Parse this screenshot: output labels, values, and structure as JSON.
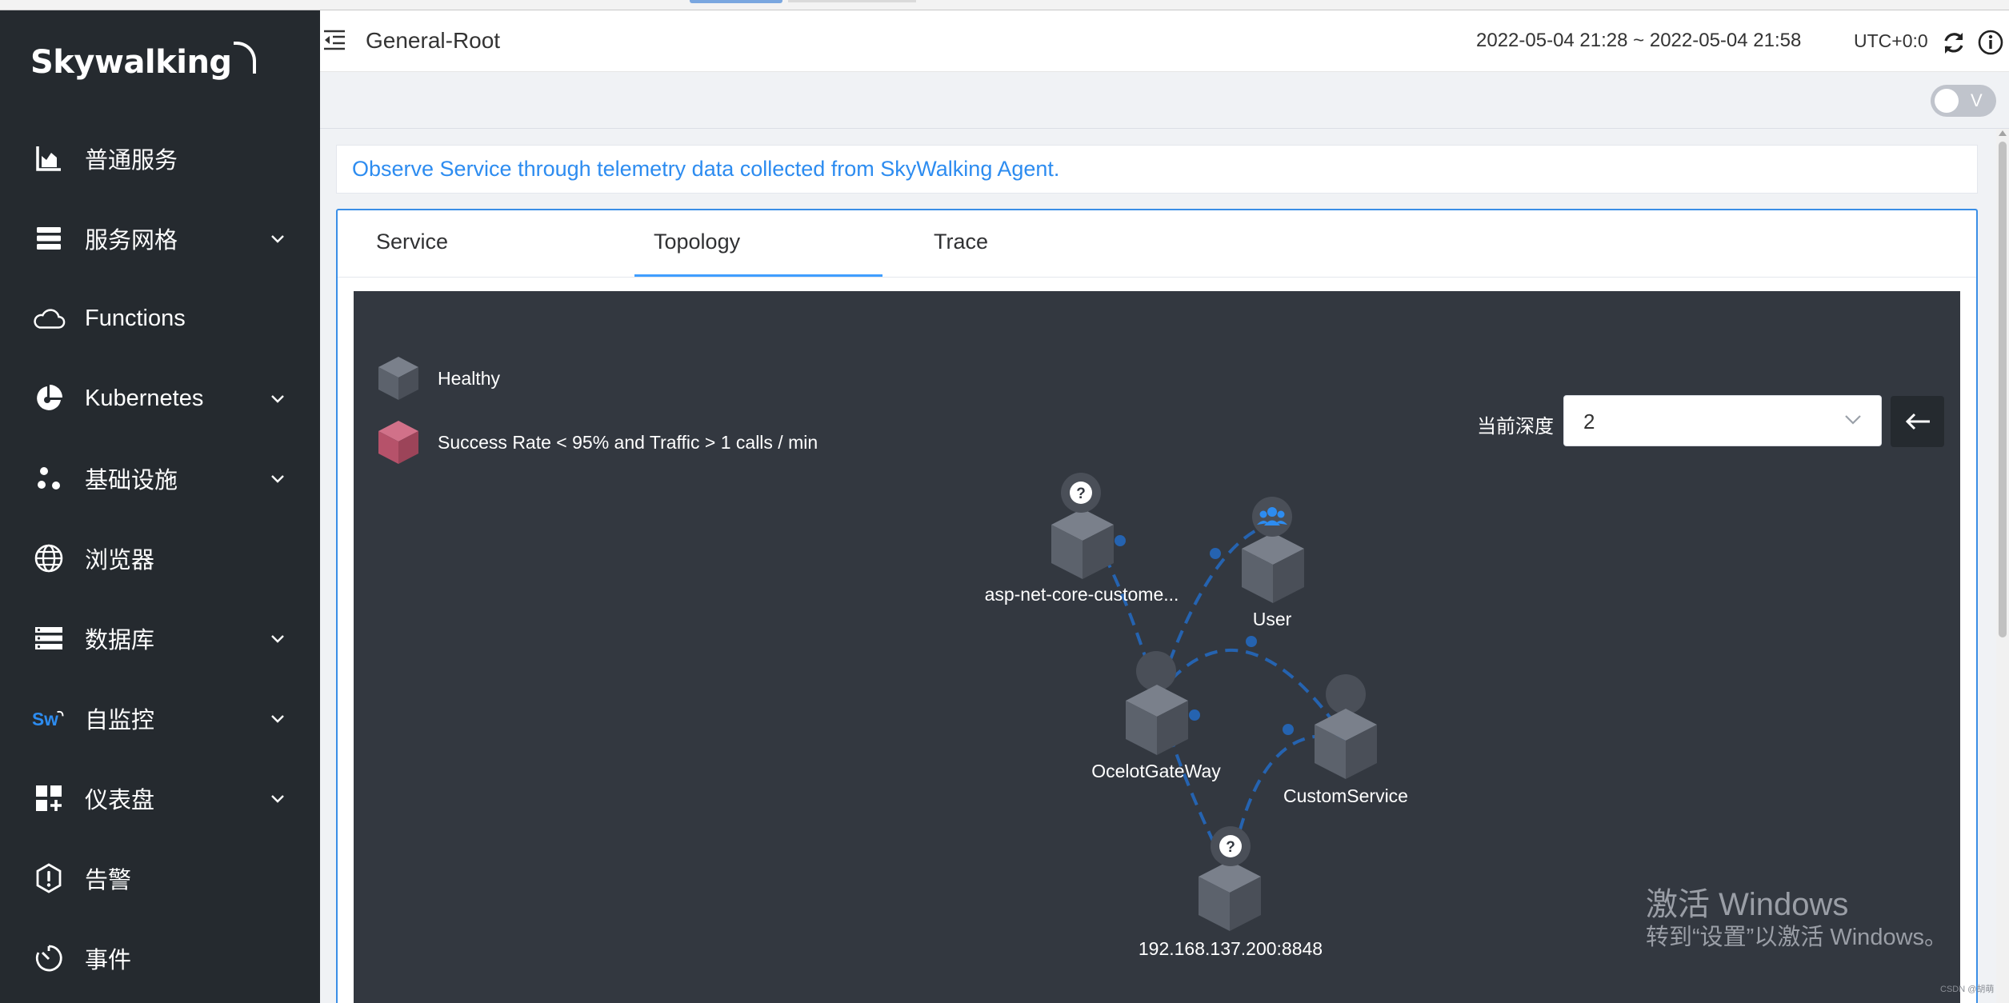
{
  "sidebar": {
    "logo": "Skywalking",
    "items": [
      {
        "label": "普通服务",
        "icon": "bar-chart-icon",
        "expandable": false
      },
      {
        "label": "服务网格",
        "icon": "layers-icon",
        "expandable": true
      },
      {
        "label": "Functions",
        "icon": "cloud-icon",
        "expandable": false
      },
      {
        "label": "Kubernetes",
        "icon": "pie-chart-icon",
        "expandable": true
      },
      {
        "label": "基础设施",
        "icon": "dots-cluster-icon",
        "expandable": true
      },
      {
        "label": "浏览器",
        "icon": "globe-icon",
        "expandable": false
      },
      {
        "label": "数据库",
        "icon": "database-list-icon",
        "expandable": true
      },
      {
        "label": "自监控",
        "icon": "sw-logo-icon",
        "icon_text": "Sw",
        "expandable": true
      },
      {
        "label": "仪表盘",
        "icon": "dashboard-grid-icon",
        "expandable": true
      },
      {
        "label": "告警",
        "icon": "alert-shield-icon",
        "expandable": false
      },
      {
        "label": "事件",
        "icon": "timer-icon",
        "expandable": false
      }
    ]
  },
  "header": {
    "title": "General-Root",
    "time_range": "2022-05-04 21:28 ~ 2022-05-04 21:58",
    "timezone": "UTC+0:0"
  },
  "toolbar": {
    "switch_label": "V",
    "switch_on": false
  },
  "description": "Observe Service through telemetry data collected from SkyWalking Agent.",
  "tabs": [
    {
      "label": "Service",
      "active": false
    },
    {
      "label": "Topology",
      "active": true
    },
    {
      "label": "Trace",
      "active": false
    }
  ],
  "topology": {
    "legend": [
      {
        "label": "Healthy",
        "color": "#5f6570"
      },
      {
        "label": "Success Rate < 95% and Traffic > 1 calls / min",
        "color": "#b6526a"
      }
    ],
    "depth_label": "当前深度",
    "depth_value": "2",
    "nodes": [
      {
        "id": "asp",
        "label": "asp-net-core-custome...",
        "badge": "question-icon"
      },
      {
        "id": "user",
        "label": "User",
        "badge": "users-icon"
      },
      {
        "id": "gateway",
        "label": "OcelotGateWay",
        "badge": "none"
      },
      {
        "id": "custom",
        "label": "CustomService",
        "badge": "none"
      },
      {
        "id": "nacos",
        "label": "192.168.137.200:8848",
        "badge": "question-icon"
      }
    ],
    "edges": [
      {
        "from": "asp",
        "to": "gateway"
      },
      {
        "from": "user",
        "to": "gateway"
      },
      {
        "from": "gateway",
        "to": "custom"
      },
      {
        "from": "gateway",
        "to": "nacos"
      },
      {
        "from": "custom",
        "to": "nacos"
      }
    ],
    "edge_color": "#2563b0"
  },
  "watermark": {
    "line1": "激活 Windows",
    "line2": "转到“设置”以激活 Windows。"
  },
  "footer_mark": "CSDN @胡萌"
}
